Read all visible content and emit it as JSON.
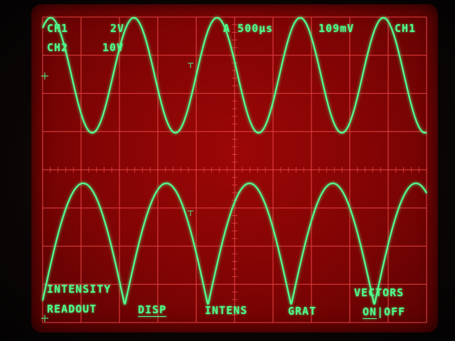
{
  "readout": {
    "ch1_label": "CH1",
    "ch1_scale": "2V",
    "ch2_label": "CH2",
    "ch2_scale": "10V",
    "timebase": "A 500µs",
    "trigger_level": "109mV",
    "trigger_source": "CH1"
  },
  "menu": {
    "intensity_line1": "INTENSITY",
    "intensity_line2": "READOUT",
    "disp": "DISP",
    "intens": "INTENS",
    "grat": "GRAT",
    "vectors": "VECTORS",
    "on": "ON",
    "separator": "|",
    "off": "OFF"
  },
  "colors": {
    "screen_red": "#8a0505",
    "graticule": "#e04040",
    "trace": "#52ff8e",
    "text": "#4dff8a"
  }
}
